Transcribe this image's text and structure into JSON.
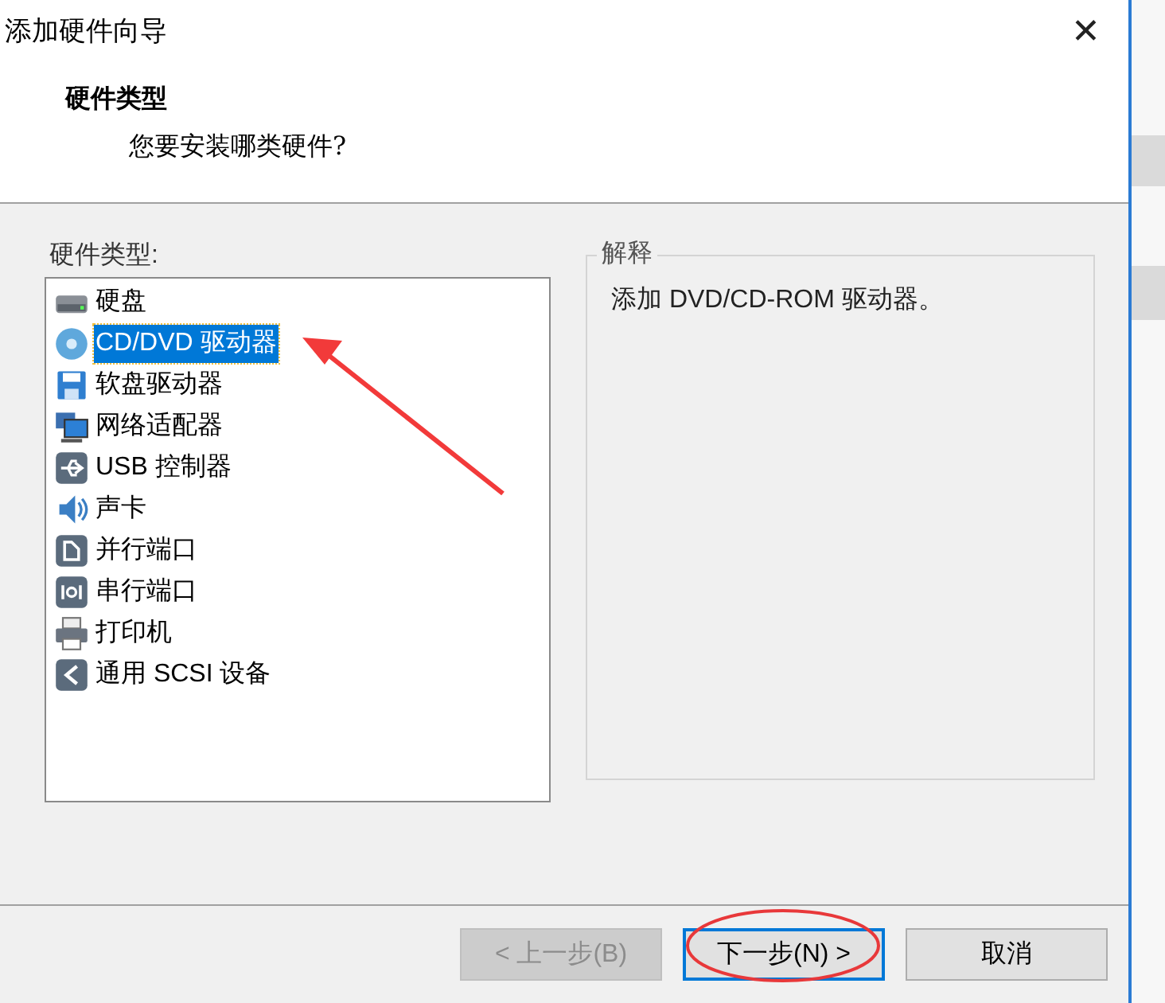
{
  "window": {
    "title": "添加硬件向导",
    "close": "✕"
  },
  "header": {
    "title": "硬件类型",
    "subtitle": "您要安装哪类硬件?"
  },
  "hardware_list": {
    "label": "硬件类型:",
    "items": [
      {
        "kind": "disk",
        "label": "硬盘",
        "selected": false
      },
      {
        "kind": "cd",
        "label": "CD/DVD 驱动器",
        "selected": true
      },
      {
        "kind": "floppy",
        "label": "软盘驱动器",
        "selected": false
      },
      {
        "kind": "network",
        "label": "网络适配器",
        "selected": false
      },
      {
        "kind": "usb",
        "label": "USB 控制器",
        "selected": false
      },
      {
        "kind": "sound",
        "label": "声卡",
        "selected": false
      },
      {
        "kind": "parallel",
        "label": "并行端口",
        "selected": false
      },
      {
        "kind": "serial",
        "label": "串行端口",
        "selected": false
      },
      {
        "kind": "printer",
        "label": "打印机",
        "selected": false
      },
      {
        "kind": "scsi",
        "label": "通用 SCSI 设备",
        "selected": false
      }
    ]
  },
  "explanation": {
    "legend": "解释",
    "text": "添加 DVD/CD-ROM 驱动器。"
  },
  "buttons": [
    {
      "label": "< 上一步(B)",
      "disabled": true,
      "default": false
    },
    {
      "label": "下一步(N) >",
      "disabled": false,
      "default": true
    },
    {
      "label": "取消",
      "disabled": false,
      "default": false
    }
  ]
}
